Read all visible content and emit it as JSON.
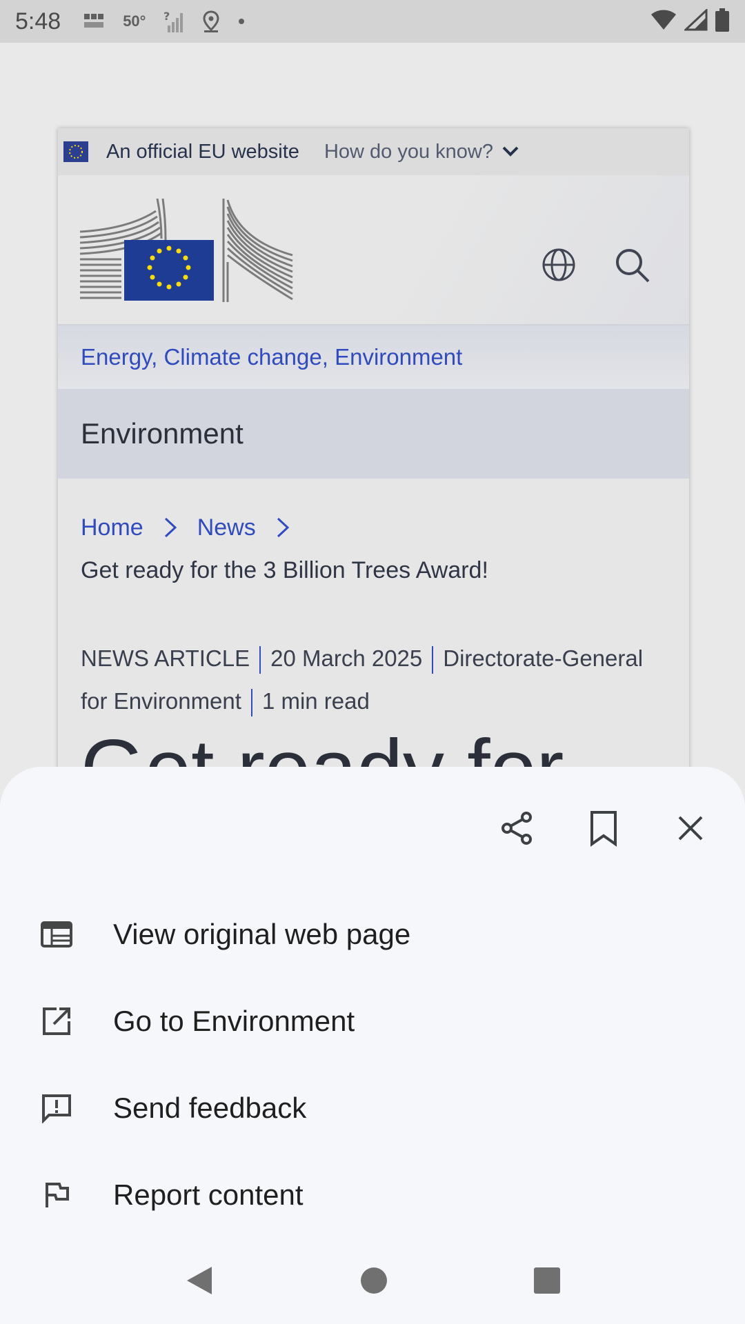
{
  "status_bar": {
    "time": "5:48",
    "icons": [
      "bbc-news-icon",
      "temperature",
      "no-signal-icon",
      "location-icon",
      "dot-icon"
    ],
    "temperature": "50°",
    "right_icons": [
      "wifi-icon",
      "cell-signal-icon",
      "battery-icon"
    ]
  },
  "web_preview": {
    "eu_banner": {
      "official_text": "An official EU website",
      "how_text": "How do you know?"
    },
    "topic": "Energy, Climate change, Environment",
    "section": "Environment",
    "breadcrumb": [
      "Home",
      "News"
    ],
    "subtitle": "Get ready for the 3 Billion Trees Award!",
    "meta": {
      "type": "NEWS ARTICLE",
      "date": "20 March 2025",
      "author": "Directorate-General for Environment",
      "read_time": "1 min read"
    },
    "big_title": "Get ready for"
  },
  "sheet": {
    "actions": [
      "share-icon",
      "bookmark-icon",
      "close-icon"
    ],
    "menu": [
      {
        "label": "View original web page",
        "icon": "web-page-icon"
      },
      {
        "label": "Go to Environment",
        "icon": "open-external-icon"
      },
      {
        "label": "Send feedback",
        "icon": "feedback-icon"
      },
      {
        "label": "Report content",
        "icon": "flag-icon"
      }
    ]
  },
  "nav_bar": [
    "back-icon",
    "home-icon",
    "recents-icon"
  ],
  "colors": {
    "link_blue": "#2f4bbf",
    "sheet_bg": "#f6f7fb",
    "eu_blue": "#1f3c94",
    "eu_gold": "#ffdd00"
  }
}
